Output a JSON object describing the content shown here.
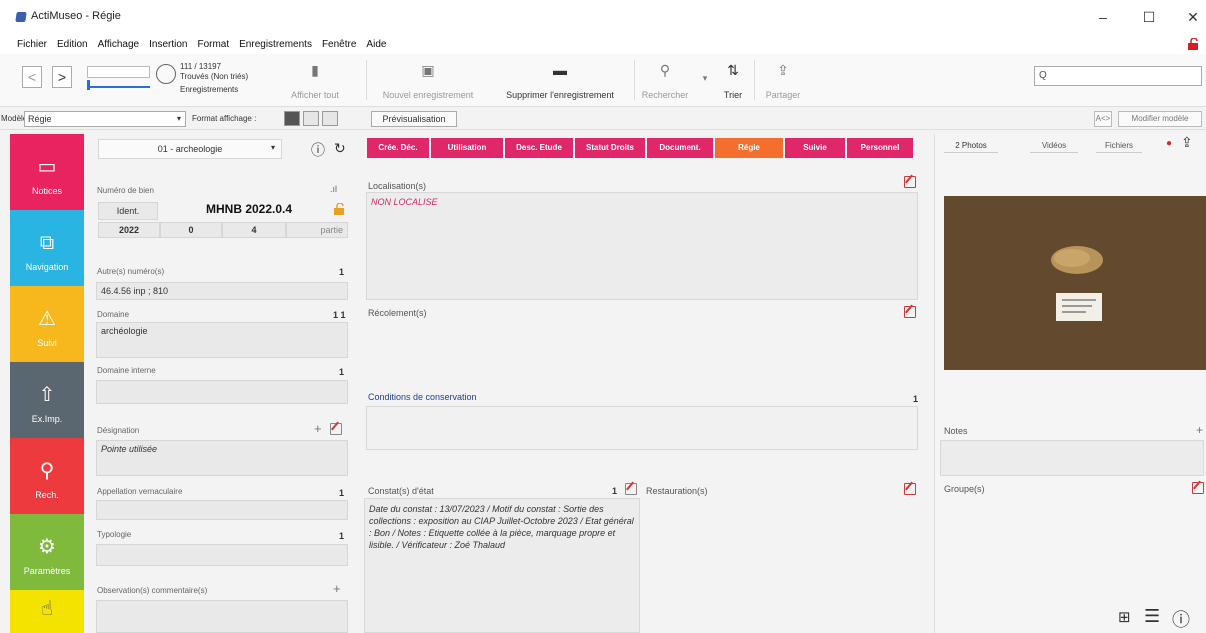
{
  "window": {
    "title": "ActiMuseo - Régie",
    "minimize": "–",
    "maximize": "☐",
    "close": "✕"
  },
  "menu": [
    "Fichier",
    "Edition",
    "Affichage",
    "Insertion",
    "Format",
    "Enregistrements",
    "Fenêtre",
    "Aide"
  ],
  "toolbar": {
    "back": "<",
    "forward": ">",
    "record_count": "111 / 13197",
    "found": "Trouvés (Non triés)",
    "records_label": "Enregistrements",
    "show_all": "Afficher tout",
    "new_record": "Nouvel enregistrement",
    "delete_record": "Supprimer l'enregistrement",
    "search": "Rechercher",
    "sort": "Trier",
    "share": "Partager",
    "search_placeholder": "Q"
  },
  "modelbar": {
    "model_label": "Modèle :",
    "model_value": "Régie",
    "format_label": "Format affichage :",
    "preview": "Prévisualisation",
    "aa": "A<>",
    "edit_model": "Modifier modèle"
  },
  "nav": [
    {
      "label": "Notices",
      "color": "#e8235f",
      "icon": "▭"
    },
    {
      "label": "Navigation",
      "color": "#29b4e1",
      "icon": "⧉"
    },
    {
      "label": "Suivi",
      "color": "#f7b81d",
      "icon": "⚠"
    },
    {
      "label": "Ex.Imp.",
      "color": "#5b6770",
      "icon": "⇧"
    },
    {
      "label": "Rech.",
      "color": "#ec3a3f",
      "icon": "⚲"
    },
    {
      "label": "Paramètres",
      "color": "#7fba3d",
      "icon": "⚙"
    },
    {
      "label": "",
      "color": "#f4e300",
      "icon": "☝"
    }
  ],
  "form": {
    "domain_selector": "01 - archeologie",
    "inventory_label": "Numéro de bien",
    "ident_label": "Ident.",
    "inventory_number": "MHNB 2022.0.4",
    "inv_year": "2022",
    "inv_part1": "0",
    "inv_part2": "4",
    "inv_part_label": "partie",
    "other_numbers_label": "Autre(s) numéro(s)",
    "other_numbers_count": "1",
    "other_numbers_value": "46.4.56 inp ; 810",
    "domain_label": "Domaine",
    "domain_count": "1 1",
    "domain_value": "archéologie",
    "internal_domain_label": "Domaine interne",
    "internal_domain_count": "1",
    "designation_label": "Désignation",
    "designation_value": "Pointe utilisée",
    "vernacular_label": "Appellation vernaculaire",
    "vernacular_count": "1",
    "typology_label": "Typologie",
    "typology_count": "1",
    "observations_label": "Observation(s) commentaire(s)"
  },
  "tabs": [
    "Crée. Déc.",
    "Utilisation",
    "Desc. Etude",
    "Statut Droits",
    "Document.",
    "Régie",
    "Suivie",
    "Personnel"
  ],
  "center": {
    "locations_label": "Localisation(s)",
    "locations_value": "NON LOCALISE",
    "packaging_label": "Récolement(s)",
    "conservation_label": "Conditions de conservation",
    "conservation_count": "1",
    "condition_label": "Constat(s) d'état",
    "condition_count": "1",
    "condition_value": "Date du constat : 13/07/2023 / Motif du constat : Sortie des collections : exposition au CIAP Juillet-Octobre 2023 / Etat général : Bon / Notes : Etiquette collée à la pièce, marquage propre et lisible. / Vérificateur : Zoé Thalaud",
    "restoration_label": "Restauration(s)"
  },
  "right": {
    "tabs": [
      "2 Photos",
      "Vidéos",
      "Fichiers"
    ],
    "notes_label": "Notes",
    "groups_label": "Groupe(s)"
  }
}
